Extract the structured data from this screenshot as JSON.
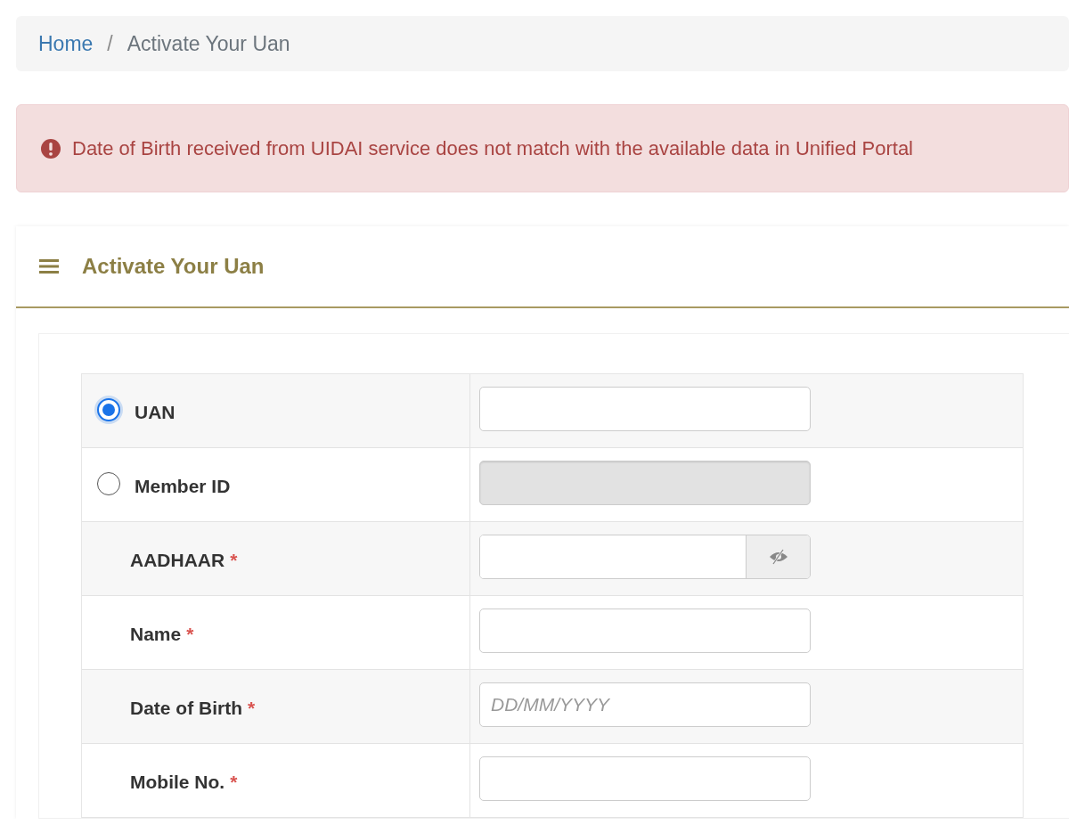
{
  "breadcrumb": {
    "separator": "/",
    "items": [
      {
        "label": "Home",
        "kind": "link"
      },
      {
        "label": "Activate Your Uan",
        "kind": "current"
      }
    ]
  },
  "alert": {
    "message": "Date of Birth received from UIDAI service does not match with the available data in Unified Portal"
  },
  "card": {
    "title": "Activate Your Uan"
  },
  "form": {
    "required_mark": "*",
    "rows": [
      {
        "kind": "radio",
        "label": "UAN",
        "selected": true,
        "field": {
          "kind": "text",
          "disabled": false
        }
      },
      {
        "kind": "radio",
        "label": "Member ID",
        "selected": false,
        "field": {
          "kind": "text",
          "disabled": true
        }
      },
      {
        "kind": "label",
        "label": "AADHAAR",
        "required": true,
        "field": {
          "kind": "secret"
        }
      },
      {
        "kind": "label",
        "label": "Name",
        "required": true,
        "field": {
          "kind": "text",
          "disabled": false
        }
      },
      {
        "kind": "label",
        "label": "Date of Birth",
        "required": true,
        "field": {
          "kind": "text",
          "disabled": false,
          "placeholder": "DD/MM/YYYY"
        }
      },
      {
        "kind": "label",
        "label": "Mobile No.",
        "required": true,
        "field": {
          "kind": "text",
          "disabled": false
        }
      }
    ]
  }
}
